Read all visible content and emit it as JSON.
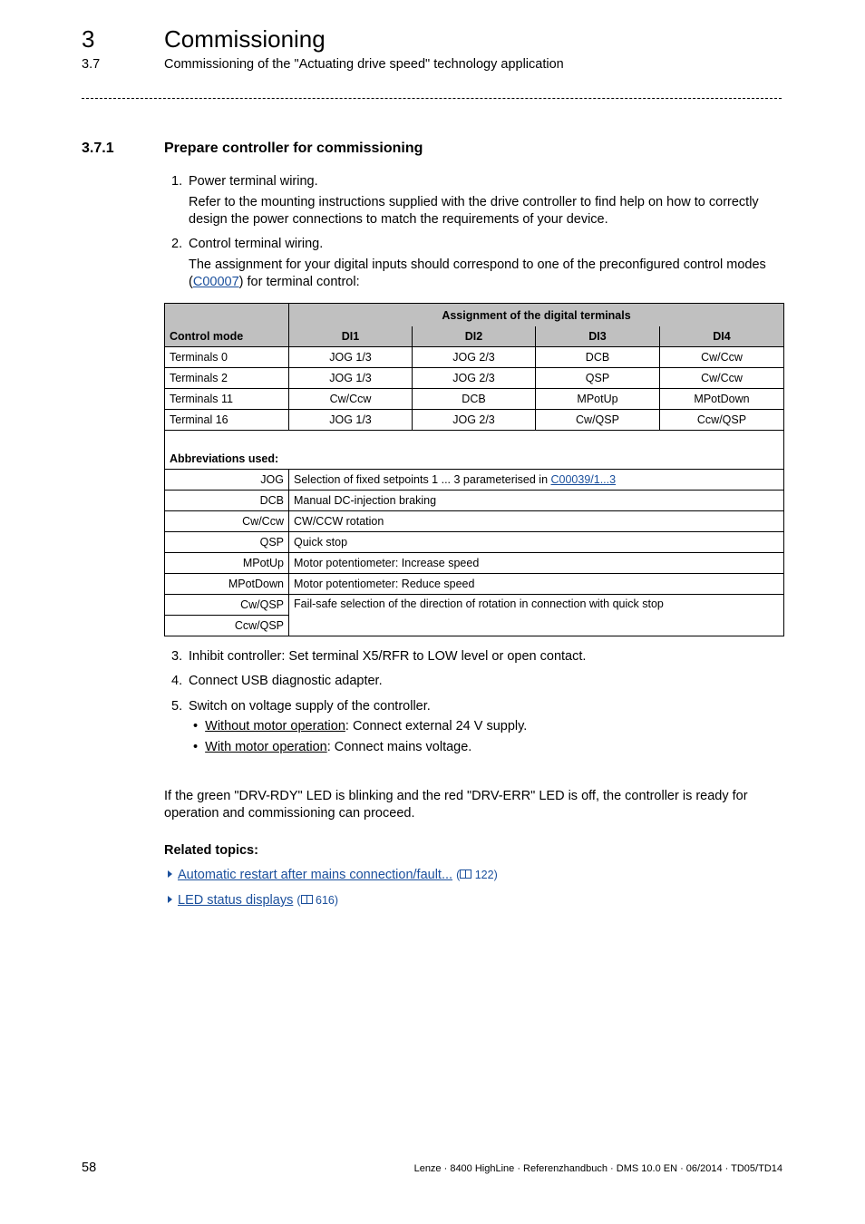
{
  "header": {
    "chapter_number": "3",
    "chapter_title": "Commissioning",
    "section_number": "3.7",
    "section_title": "Commissioning of the \"Actuating drive speed\" technology application"
  },
  "subsection": {
    "number": "3.7.1",
    "title": "Prepare controller for commissioning"
  },
  "steps": [
    {
      "num": "1.",
      "title": "Power terminal wiring.",
      "body": "Refer to the mounting instructions supplied with the drive controller to find help on how to correctly design the power connections to match the requirements of your device."
    },
    {
      "num": "2.",
      "title": "Control terminal wiring.",
      "body_before": "The assignment for your digital inputs should correspond to one of the preconfigured control modes (",
      "body_link": "C00007",
      "body_after": ") for terminal control:"
    },
    {
      "num": "3.",
      "title": "Inhibit controller: Set terminal X5/RFR to LOW level or open contact."
    },
    {
      "num": "4.",
      "title": "Connect USB diagnostic adapter."
    },
    {
      "num": "5.",
      "title": "Switch on voltage supply of the controller.",
      "bullets": [
        {
          "label": "Without motor operation",
          "text": ": Connect external 24 V supply."
        },
        {
          "label": "With motor operation",
          "text": ": Connect mains voltage."
        }
      ]
    }
  ],
  "table": {
    "group_header": "Assignment of the digital terminals",
    "columns": [
      "Control mode",
      "DI1",
      "DI2",
      "DI3",
      "DI4"
    ],
    "rows": [
      [
        "Terminals 0",
        "JOG 1/3",
        "JOG 2/3",
        "DCB",
        "Cw/Ccw"
      ],
      [
        "Terminals 2",
        "JOG 1/3",
        "JOG 2/3",
        "QSP",
        "Cw/Ccw"
      ],
      [
        "Terminals 11",
        "Cw/Ccw",
        "DCB",
        "MPotUp",
        "MPotDown"
      ],
      [
        "Terminal 16",
        "JOG 1/3",
        "JOG 2/3",
        "Cw/QSP",
        "Ccw/QSP"
      ]
    ],
    "abbrev_title": "Abbreviations used:",
    "abbreviations": [
      {
        "abbr": "JOG",
        "desc": "Selection of fixed setpoints 1 ... 3 parameterised in ",
        "link": "C00039/1...3"
      },
      {
        "abbr": "DCB",
        "desc": "Manual DC-injection braking"
      },
      {
        "abbr": "Cw/Ccw",
        "desc": "CW/CCW rotation"
      },
      {
        "abbr": "QSP",
        "desc": "Quick stop"
      },
      {
        "abbr": "MPotUp",
        "desc": "Motor potentiometer: Increase speed"
      },
      {
        "abbr": "MPotDown",
        "desc": "Motor potentiometer: Reduce speed"
      },
      {
        "abbr": "Cw/QSP",
        "desc": "Fail-safe selection of the direction of rotation in connection with quick stop"
      },
      {
        "abbr": "Ccw/QSP",
        "desc": ""
      }
    ]
  },
  "note": "If the green \"DRV-RDY\" LED is blinking and the red \"DRV-ERR\" LED is off, the controller is ready for operation and commissioning can proceed.",
  "related": {
    "title": "Related topics:",
    "items": [
      {
        "label": "Automatic restart after mains connection/fault...",
        "page": "122",
        "icon": "book-icon"
      },
      {
        "label": "LED status displays",
        "page": "616",
        "icon": "book-icon"
      }
    ]
  },
  "footer": {
    "page_number": "58",
    "text": "Lenze · 8400 HighLine · Referenzhandbuch · DMS 10.0 EN · 06/2014 · TD05/TD14"
  },
  "colors": {
    "link": "#1a4f9c",
    "table_header_bg": "#c0c0c0"
  }
}
